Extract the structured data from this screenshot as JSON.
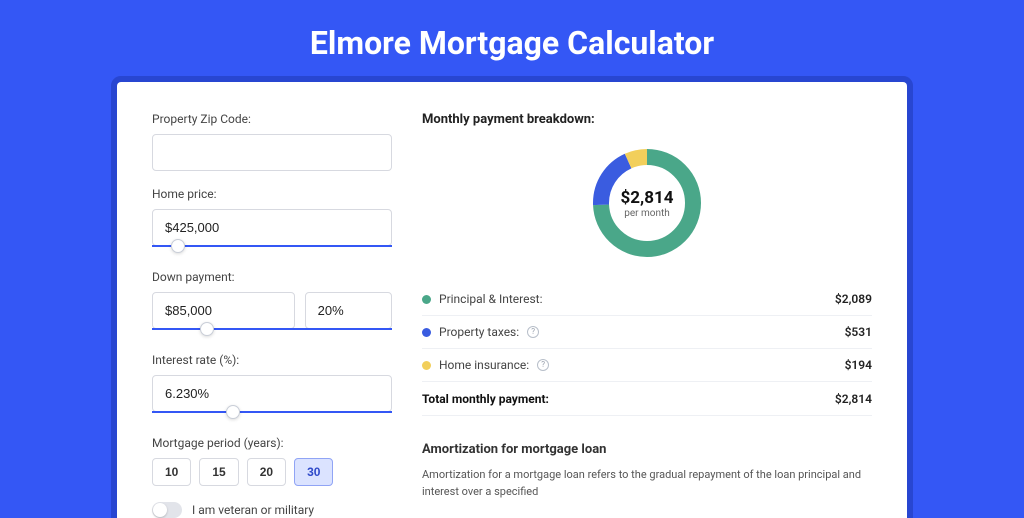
{
  "page": {
    "title": "Elmore Mortgage Calculator"
  },
  "form": {
    "zip_label": "Property Zip Code:",
    "zip_value": "",
    "price_label": "Home price:",
    "price_value": "$425,000",
    "price_slider_pct": 8,
    "down_label": "Down payment:",
    "down_amount": "$85,000",
    "down_pct": "20%",
    "down_slider_pct": 20,
    "rate_label": "Interest rate (%):",
    "rate_value": "6.230%",
    "rate_slider_pct": 31,
    "period_label": "Mortgage period (years):",
    "periods": [
      "10",
      "15",
      "20",
      "30"
    ],
    "period_active": "30",
    "veteran_label": "I am veteran or military"
  },
  "breakdown": {
    "title": "Monthly payment breakdown:",
    "total_display": "$2,814",
    "total_sub": "per month",
    "items": [
      {
        "label": "Principal & Interest:",
        "value": "$2,089",
        "color": "#4aa789",
        "help": false
      },
      {
        "label": "Property taxes:",
        "value": "$531",
        "color": "#3a5ce0",
        "help": true
      },
      {
        "label": "Home insurance:",
        "value": "$194",
        "color": "#f2cf5b",
        "help": true
      }
    ],
    "total_label": "Total monthly payment:",
    "total_value": "$2,814"
  },
  "amort": {
    "title": "Amortization for mortgage loan",
    "body": "Amortization for a mortgage loan refers to the gradual repayment of the loan principal and interest over a specified"
  },
  "chart_data": {
    "type": "pie",
    "title": "Monthly payment breakdown",
    "categories": [
      "Principal & Interest",
      "Property taxes",
      "Home insurance"
    ],
    "values": [
      2089,
      531,
      194
    ],
    "colors": [
      "#4aa789",
      "#3a5ce0",
      "#f2cf5b"
    ],
    "total": 2814,
    "unit": "USD/month"
  }
}
